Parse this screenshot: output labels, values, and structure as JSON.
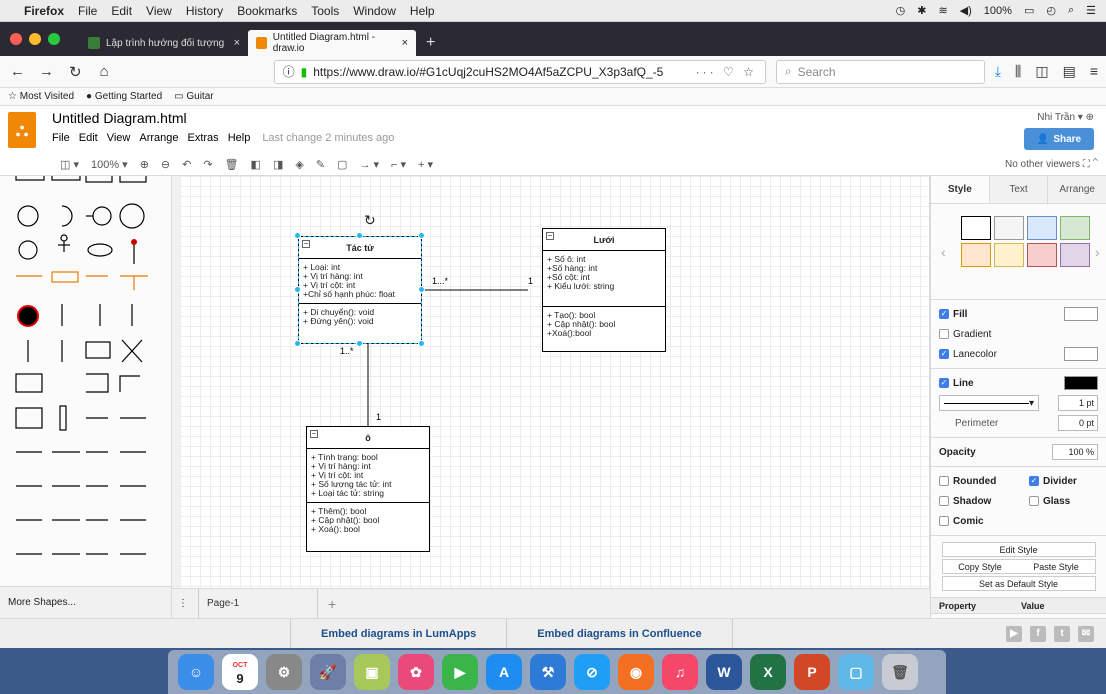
{
  "menubar": {
    "app": "Firefox",
    "items": [
      "File",
      "Edit",
      "View",
      "History",
      "Bookmarks",
      "Tools",
      "Window",
      "Help"
    ],
    "battery": "100%"
  },
  "tabs": [
    {
      "label": "Lập trình hướng đối tượng",
      "favicon_color": "#3a7d3a"
    },
    {
      "label": "Untitled Diagram.html - draw.io",
      "favicon_color": "#f08705"
    }
  ],
  "nav": {
    "url": "https://www.draw.io/#G1cUqj2cuHS2MO4Af5aZCPU_X3p3afQ_-5",
    "search_placeholder": "Search"
  },
  "bookmarks": [
    "Most Visited",
    "Getting Started",
    "Guitar"
  ],
  "drawio": {
    "title": "Untitled Diagram.html",
    "menu": [
      "File",
      "Edit",
      "View",
      "Arrange",
      "Extras",
      "Help"
    ],
    "last_change": "Last change 2 minutes ago",
    "user": "Nhi Trần",
    "share": "Share",
    "zoom": "100%",
    "viewers": "No other viewers",
    "more_shapes": "More Shapes...",
    "page_tab": "Page-1"
  },
  "diagram": {
    "classes": [
      {
        "name": "Tác tử",
        "attributes": [
          "+ Loại: int",
          "+ Vị trí hàng: int",
          "+ Vị trí cột: int",
          "+Chỉ số hạnh phúc: float"
        ],
        "methods": [
          "+ Di chuyển(): void",
          "+ Đứng yên(): void"
        ]
      },
      {
        "name": "Lưới",
        "attributes": [
          "+ Số ô: int",
          "+Số hàng: int",
          "+Số cột: int",
          "+ Kiểu lưới: string"
        ],
        "methods": [
          "+ Tạo(): bool",
          "+ Cập nhật(): bool",
          "+Xoá():bool"
        ]
      },
      {
        "name": "ô",
        "attributes": [
          "+ Tình trạng: bool",
          "+ Vị trí hàng: int",
          "+ Vị trí cột: int",
          "+ Số lượng tác tử: int",
          "+ Loại tác tử: string"
        ],
        "methods": [
          "+ Thêm(): bool",
          "+ Cập nhật(): bool",
          "+ Xoá(): bool"
        ]
      }
    ],
    "multiplicities": {
      "tac_tu_to_luoi_left": "1...*",
      "tac_tu_to_luoi_right": "1",
      "tac_tu_to_o_top": "1..*",
      "tac_tu_to_o_bottom": "1"
    }
  },
  "format_panel": {
    "tabs": [
      "Style",
      "Text",
      "Arrange"
    ],
    "swatch_colors": [
      "#ffffff",
      "#f5f5f5",
      "#dae8fc",
      "#d5e8d4",
      "#ffe6cc",
      "#fff2cc",
      "#f8cecc",
      "#e1d5e7"
    ],
    "fill": "Fill",
    "gradient": "Gradient",
    "lanecolor": "Lanecolor",
    "line": "Line",
    "line_width": "1 pt",
    "perimeter": "Perimeter",
    "perimeter_value": "0 pt",
    "opacity": "Opacity",
    "opacity_value": "100 %",
    "rounded": "Rounded",
    "divider": "Divider",
    "shadow": "Shadow",
    "glass": "Glass",
    "comic": "Comic",
    "edit_style": "Edit Style",
    "copy_style": "Copy Style",
    "paste_style": "Paste Style",
    "set_default": "Set as Default Style",
    "property": "Property",
    "value": "Value"
  },
  "footer": {
    "lumapps": "Embed diagrams in LumApps",
    "confluence": "Embed diagrams in Confluence"
  },
  "dock": {
    "calendar_month": "OCT",
    "calendar_day": "9"
  }
}
